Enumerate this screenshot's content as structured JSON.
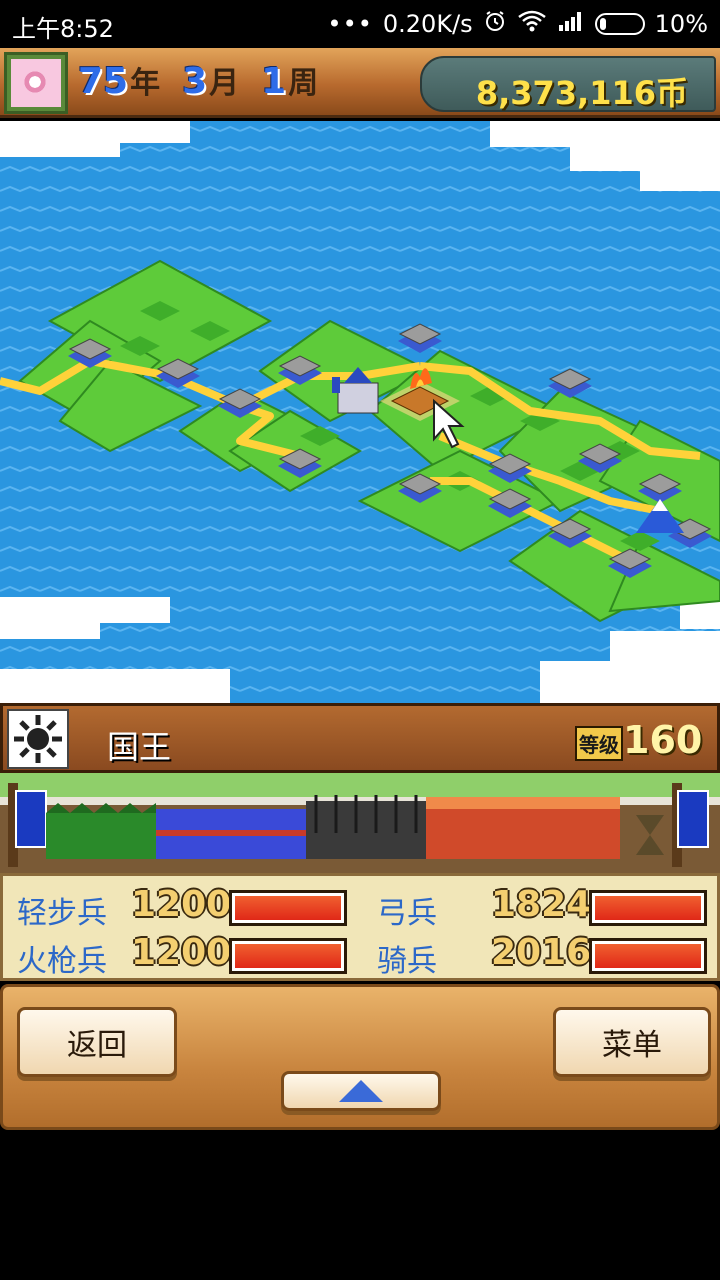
{
  "status_bar": {
    "time": "上午8:52",
    "dots": "•••",
    "network_speed": "0.20K/s",
    "battery_percent": "10%",
    "icons": [
      "alarm-icon",
      "wifi-icon",
      "signal-icon",
      "battery-icon"
    ]
  },
  "header": {
    "year_number": "75",
    "year_unit": "年",
    "month_number": "3",
    "month_unit": "月",
    "week_number": "1",
    "week_unit": "周",
    "coins": "8,373,116币"
  },
  "king_panel": {
    "name": "国王",
    "rank_label": "等级",
    "rank_value": "160"
  },
  "troops": [
    {
      "label": "轻步兵",
      "value": "1200",
      "bar_fill": 1.0
    },
    {
      "label": "弓兵",
      "value": "1824",
      "bar_fill": 1.0
    },
    {
      "label": "火枪兵",
      "value": "1200",
      "bar_fill": 1.0
    },
    {
      "label": "骑兵",
      "value": "2016",
      "bar_fill": 1.0
    }
  ],
  "nav": {
    "back_label": "返回",
    "menu_label": "菜单"
  },
  "colors": {
    "sea": "#2a96e0",
    "land": "#5ecb3a",
    "road": "#ffd23a",
    "troop_label": "#2c68c8",
    "bar_fill": "#e83a20"
  }
}
